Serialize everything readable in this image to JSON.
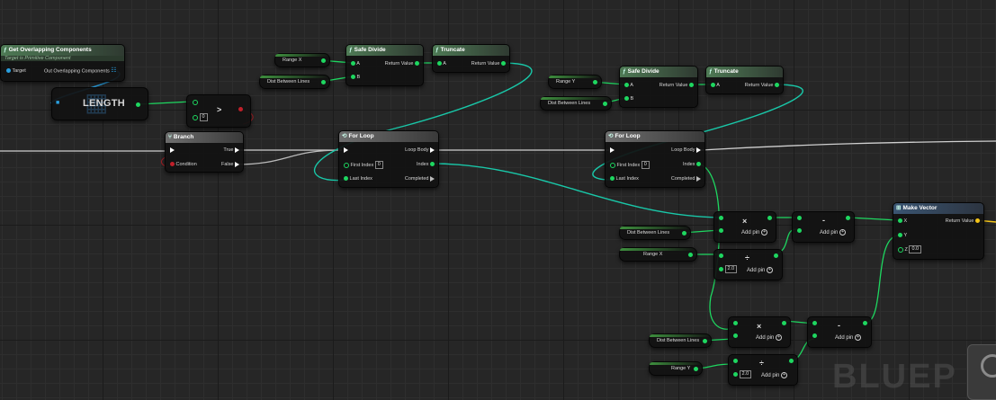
{
  "canvas": {
    "watermark": "BLUEP"
  },
  "get_overlapping": {
    "title": "Get Overlapping Components",
    "subtitle": "Target is Primitive Component",
    "pin_target": "Target",
    "pin_out": "Out Overlapping Components"
  },
  "length_node": {
    "label": "LENGTH"
  },
  "greater_node": {
    "symbol": ">",
    "default": "0"
  },
  "branch": {
    "title": "Branch",
    "pin_true": "True",
    "pin_condition": "Condition",
    "pin_false": "False"
  },
  "range_x_var": "Range X",
  "range_y_var": "Range Y",
  "dist_var": "Dist Between Lines",
  "safe_divide_1": {
    "title": "Safe Divide",
    "pin_a": "A",
    "pin_b": "B",
    "pin_ret": "Return Value"
  },
  "truncate_1": {
    "title": "Truncate",
    "pin_a": "A",
    "pin_ret": "Return Value"
  },
  "safe_divide_2": {
    "title": "Safe Divide",
    "pin_a": "A",
    "pin_b": "B",
    "pin_ret": "Return Value"
  },
  "truncate_2": {
    "title": "Truncate",
    "pin_a": "A",
    "pin_ret": "Return Value"
  },
  "for_loop_1": {
    "title": "For Loop",
    "pin_loop_body": "Loop Body",
    "pin_first": "First Index",
    "first_value": "0",
    "pin_index": "Index",
    "pin_last": "Last Index",
    "pin_completed": "Completed"
  },
  "for_loop_2": {
    "title": "For Loop",
    "pin_loop_body": "Loop Body",
    "pin_first": "First Index",
    "first_value": "0",
    "pin_index": "Index",
    "pin_last": "Last Index",
    "pin_completed": "Completed"
  },
  "math": {
    "multiply_symbol": "×",
    "divide_symbol": "÷",
    "subtract_symbol": "-",
    "add_pin": "Add pin",
    "divide_default": "2.0"
  },
  "make_vector": {
    "title": "Make Vector",
    "pin_x": "X",
    "pin_y": "Y",
    "pin_z": "Z",
    "z_value": "0.0",
    "pin_ret": "Return Value"
  },
  "colors": {
    "float_pin": "#1ed760",
    "object_pin": "#2aa0e0",
    "bool_pin": "#c0202a",
    "vector_pin": "#f5c518",
    "exec_wire": "#d8d8d8"
  }
}
